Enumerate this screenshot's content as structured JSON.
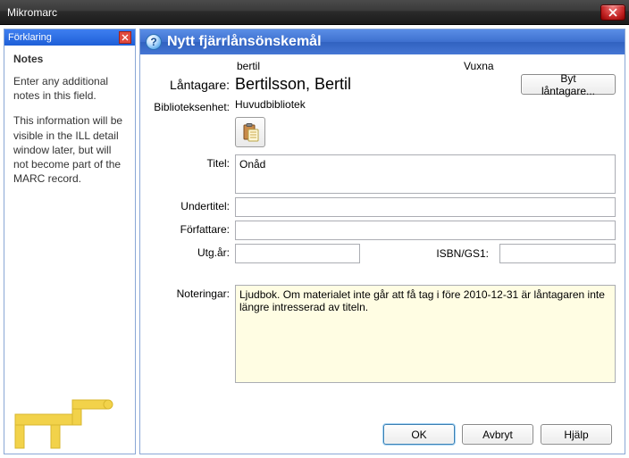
{
  "window": {
    "title": "Mikromarc"
  },
  "sidebar": {
    "header": "Förklaring",
    "title": "Notes",
    "p1": "Enter any additional notes in this field.",
    "p2": "This information will be visible in the ILL detail window later, but will not become part of the MARC record."
  },
  "main": {
    "header": "Nytt fjärrlånsönskemål",
    "meta_username": "bertil",
    "meta_category": "Vuxna",
    "labels": {
      "borrower": "Låntagare:",
      "library_unit": "Biblioteksenhet:",
      "title": "Titel:",
      "subtitle": "Undertitel:",
      "author": "Författare:",
      "pub_year": "Utg.år:",
      "isbn": "ISBN/GS1:",
      "notes": "Noteringar:"
    },
    "values": {
      "borrower_name": "Bertilsson, Bertil",
      "library_unit": "Huvudbibliotek",
      "title": "Onåd",
      "subtitle": "",
      "author": "",
      "pub_year": "",
      "isbn": "",
      "notes": "Ljudbok. Om materialet inte går att få tag i före 2010-12-31 är låntagaren inte längre intresserad av titeln."
    },
    "buttons": {
      "change_borrower": "Byt låntagare...",
      "ok": "OK",
      "cancel": "Avbryt",
      "help": "Hjälp"
    }
  }
}
